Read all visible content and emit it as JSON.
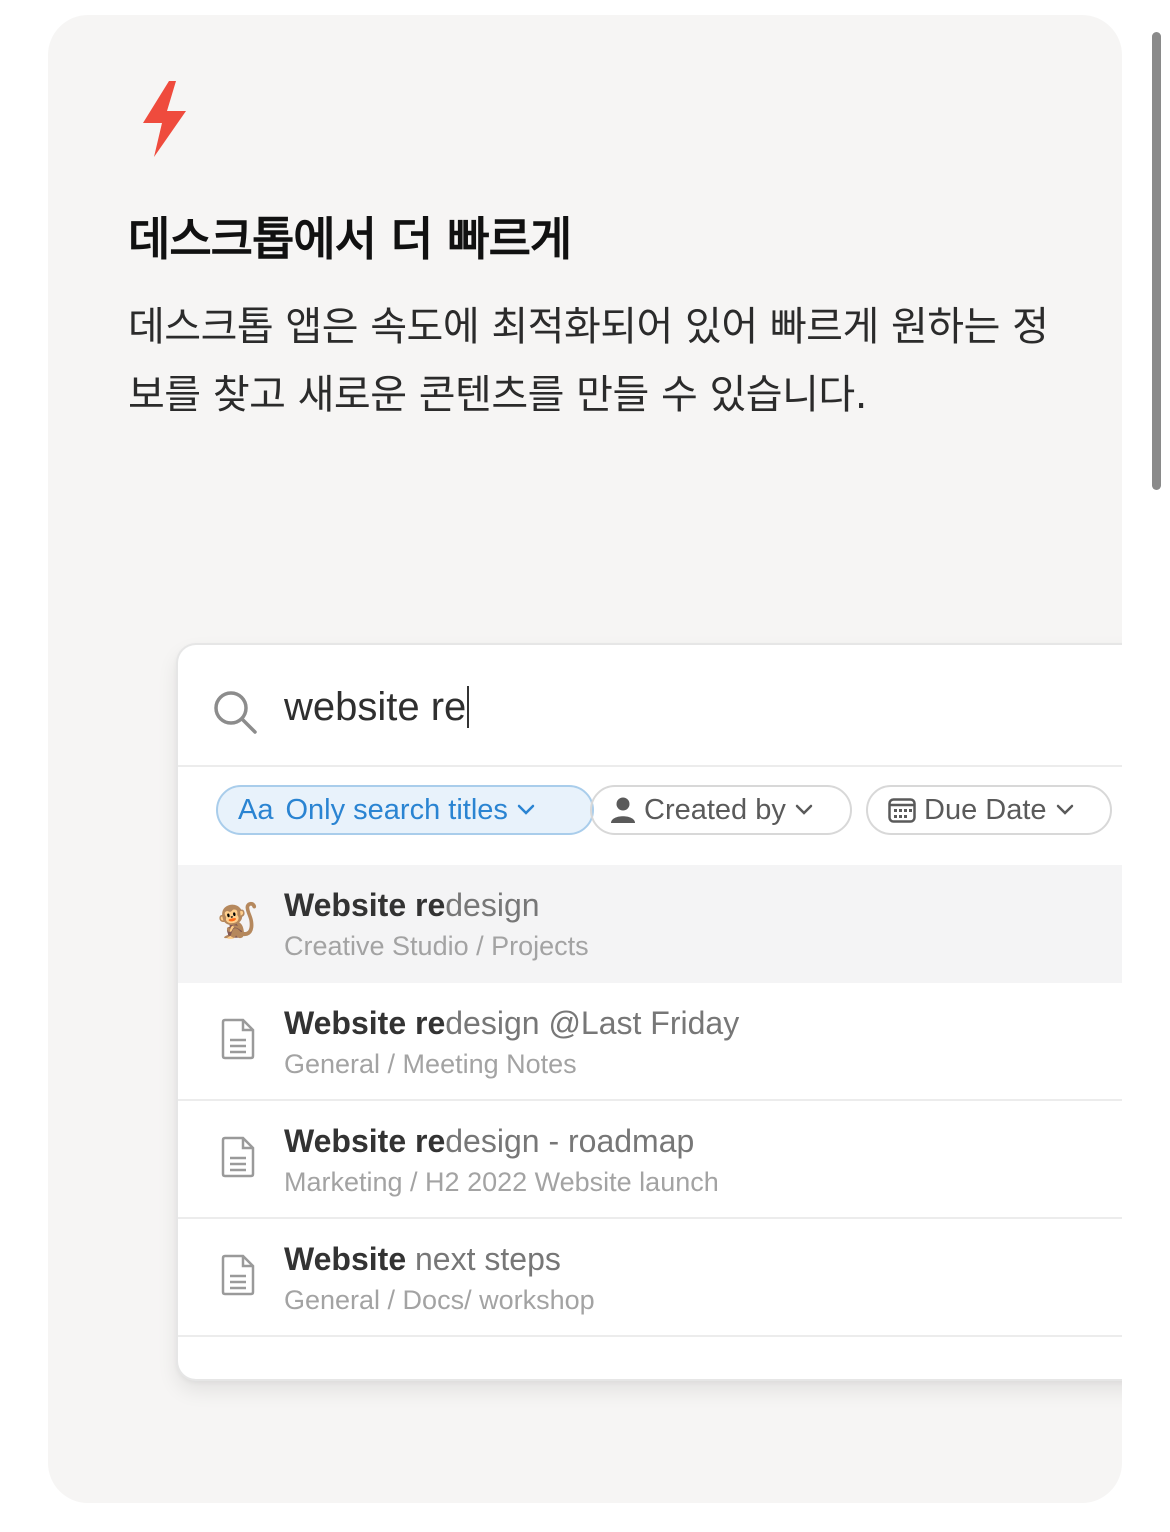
{
  "card": {
    "icon": "lightning-bolt-icon",
    "accent_color": "#ef4b3d",
    "title": "데스크톱에서 더 빠르게",
    "description": "데스크톱 앱은 속도에 최적화되어 있어 빠르게 원하는 정보를 찾고 새로운 콘텐츠를 만들 수 있습니다."
  },
  "search": {
    "icon": "search-icon",
    "query": "website re"
  },
  "filters": [
    {
      "icon": "",
      "prefix": "Aa",
      "label": "Only search titles",
      "active": true
    },
    {
      "icon": "person-icon",
      "prefix": "",
      "label": "Created by",
      "active": false
    },
    {
      "icon": "calendar-icon",
      "prefix": "",
      "label": "Due Date",
      "active": false
    }
  ],
  "results": [
    {
      "icon": "monkey-emoji-icon",
      "emoji": "🐒",
      "match_a": "Website",
      "gap": " ",
      "match_b": "re",
      "rest": "design",
      "path": "Creative Studio / Projects",
      "selected": true
    },
    {
      "icon": "document-icon",
      "emoji": "",
      "match_a": "Website",
      "gap": " ",
      "match_b": "re",
      "rest": "design @Last Friday",
      "path": "General / Meeting Notes",
      "selected": false
    },
    {
      "icon": "document-icon",
      "emoji": "",
      "match_a": "Website",
      "gap": " ",
      "match_b": "re",
      "rest": "design - roadmap",
      "path": "Marketing / H2 2022 Website launch",
      "selected": false
    },
    {
      "icon": "document-icon",
      "emoji": "",
      "match_a": "Website",
      "gap": " ",
      "match_b": "",
      "rest": "next steps",
      "path": "General / Docs/ workshop",
      "selected": false
    }
  ]
}
